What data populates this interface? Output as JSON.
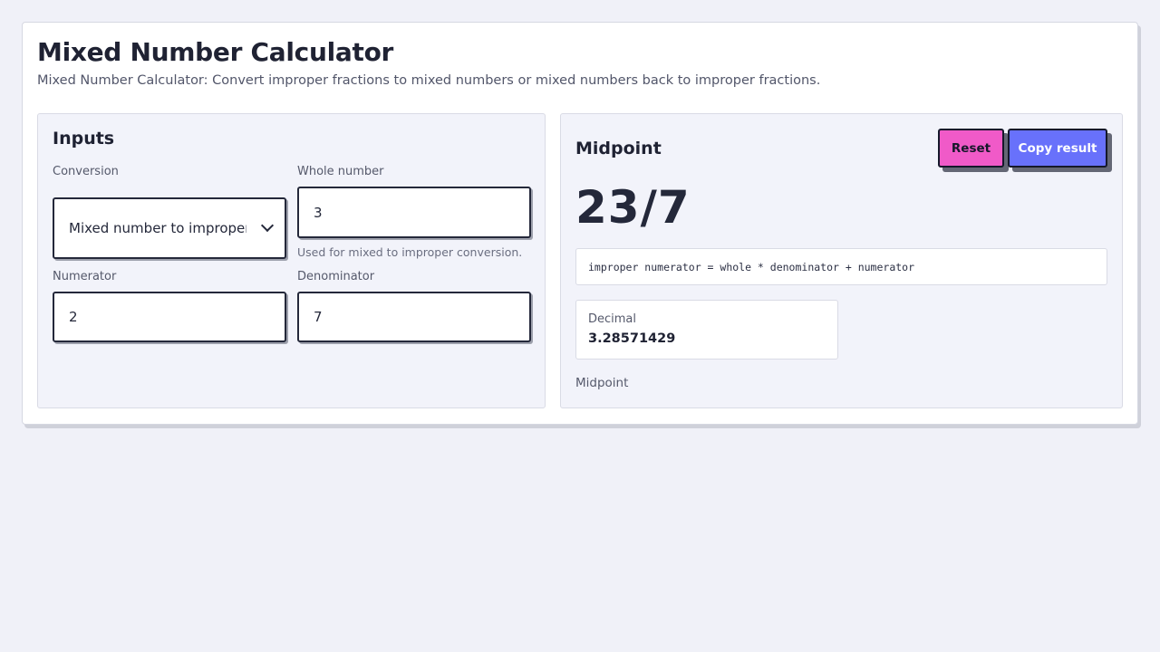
{
  "header": {
    "title": "Mixed Number Calculator",
    "subtitle": "Mixed Number Calculator: Convert improper fractions to mixed numbers or mixed numbers back to improper fractions."
  },
  "inputs": {
    "heading": "Inputs",
    "conversion": {
      "label": "Conversion",
      "value": "Mixed number to improper fraction"
    },
    "whole": {
      "label": "Whole number",
      "value": "3",
      "hint": "Used for mixed to improper conversion."
    },
    "numerator": {
      "label": "Numerator",
      "value": "2"
    },
    "denominator": {
      "label": "Denominator",
      "value": "7"
    }
  },
  "result": {
    "heading": "Midpoint",
    "reset_label": "Reset",
    "copy_label": "Copy result",
    "value": "23/7",
    "formula": "improper numerator = whole * denominator + numerator",
    "decimal_label": "Decimal",
    "decimal_value": "3.28571429",
    "footer": "Midpoint"
  },
  "colors": {
    "reset_button": "#f05ac8",
    "copy_button": "#6871fb",
    "background": "#f0f1f8"
  }
}
